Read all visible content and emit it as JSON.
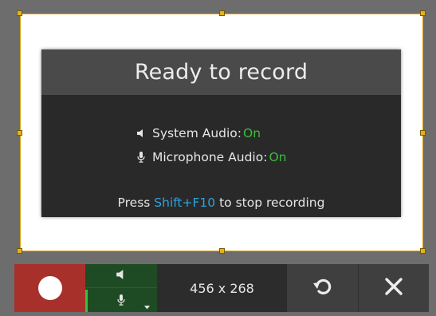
{
  "dialog": {
    "title": "Ready to record",
    "system_audio_label": "System Audio:",
    "system_audio_value": "On",
    "microphone_audio_label": "Microphone Audio:",
    "microphone_audio_value": "On",
    "stop_prefix": "Press",
    "stop_hotkey": "Shift+F10",
    "stop_suffix": "to stop recording"
  },
  "toolbar": {
    "record_icon": "record-circle-icon",
    "speaker_icon": "speaker-icon",
    "microphone_icon": "microphone-icon",
    "dropdown_icon": "chevron-down-icon",
    "selection_size": "456 x 268",
    "reset_icon": "rotate-icon",
    "close_icon": "close-icon"
  },
  "colors": {
    "record": "#a8302b",
    "audio_panel": "#1f4b24",
    "on": "#3fba3f",
    "hotkey": "#29a3e0",
    "selection_border": "#d9a31c"
  }
}
